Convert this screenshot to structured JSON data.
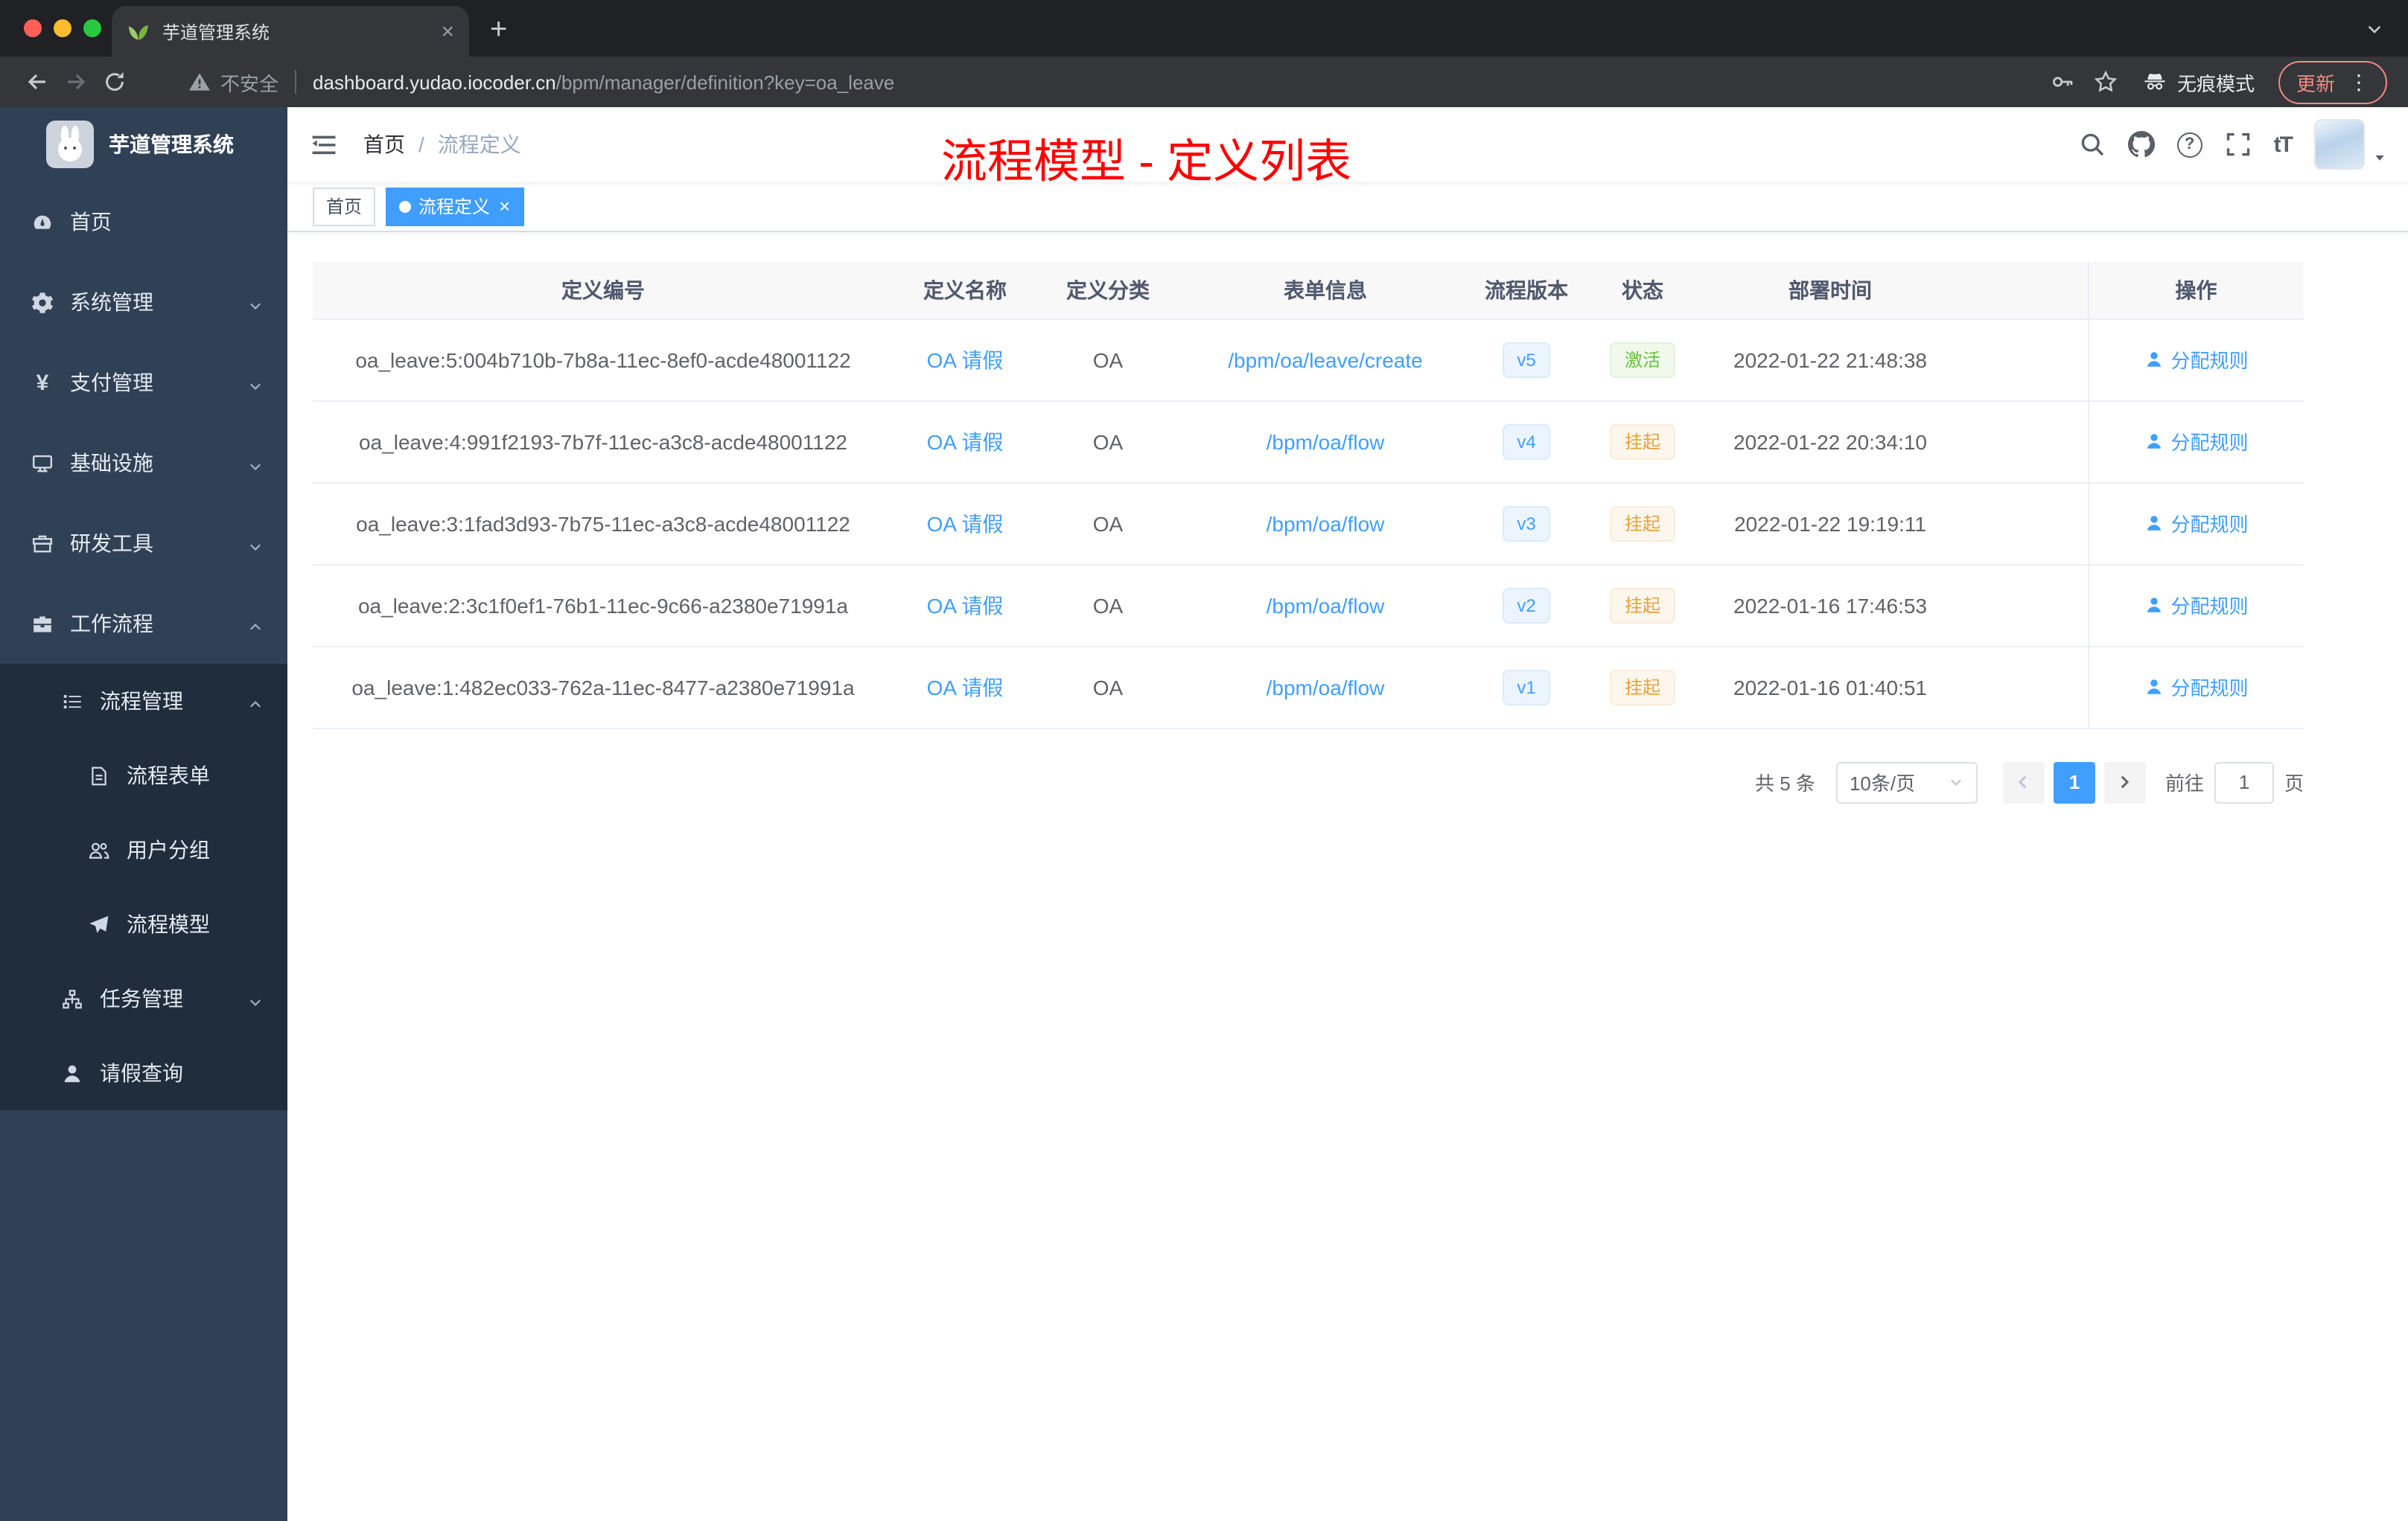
{
  "browser": {
    "tab_title": "芋道管理系统",
    "security_label": "不安全",
    "url_host": "dashboard.yudao.iocoder.cn",
    "url_path": "/bpm/manager/definition?key=oa_leave",
    "incognito_label": "无痕模式",
    "update_label": "更新"
  },
  "sidebar": {
    "title": "芋道管理系统",
    "menu": [
      {
        "name": "home",
        "label": "首页",
        "icon": "dashboard-icon",
        "level": 1
      },
      {
        "name": "system-management",
        "label": "系统管理",
        "icon": "gear-icon",
        "level": 1,
        "chevron": "down"
      },
      {
        "name": "payment-management",
        "label": "支付管理",
        "icon": "yen-icon",
        "level": 1,
        "chevron": "down"
      },
      {
        "name": "infrastructure",
        "label": "基础设施",
        "icon": "monitor-icon",
        "level": 1,
        "chevron": "down"
      },
      {
        "name": "dev-tools",
        "label": "研发工具",
        "icon": "toolbox-icon",
        "level": 1,
        "chevron": "down"
      },
      {
        "name": "workflow",
        "label": "工作流程",
        "icon": "briefcase-icon",
        "level": 1,
        "chevron": "up"
      },
      {
        "name": "process-management",
        "label": "流程管理",
        "icon": "list-icon",
        "level": 2,
        "chevron": "up",
        "sub": true
      },
      {
        "name": "process-form",
        "label": "流程表单",
        "icon": "form-icon",
        "level": 3,
        "sub": true
      },
      {
        "name": "user-group",
        "label": "用户分组",
        "icon": "group-icon",
        "level": 3,
        "sub": true
      },
      {
        "name": "process-model",
        "label": "流程模型",
        "icon": "paper-plane-icon",
        "level": 3,
        "sub": true
      },
      {
        "name": "task-management",
        "label": "任务管理",
        "icon": "org-tree-icon",
        "level": 2,
        "chevron": "down",
        "sub": true
      },
      {
        "name": "leave-query",
        "label": "请假查询",
        "icon": "person-icon",
        "level": 2,
        "sub": true
      }
    ]
  },
  "header": {
    "breadcrumb_root": "首页",
    "breadcrumb_sep": "/",
    "breadcrumb_current": "流程定义",
    "annotation": "流程模型 - 定义列表",
    "icon_glyphs": {
      "help": "?",
      "textsize": "tT"
    }
  },
  "tagsview": {
    "home": "首页",
    "active": "流程定义"
  },
  "table": {
    "columns": [
      "定义编号",
      "定义名称",
      "定义分类",
      "表单信息",
      "流程版本",
      "状态",
      "部署时间",
      "操作"
    ],
    "action_label": "分配规则",
    "rows": [
      {
        "id": "oa_leave:5:004b710b-7b8a-11ec-8ef0-acde48001122",
        "name": "OA 请假",
        "category": "OA",
        "form": "/bpm/oa/leave/create",
        "version": "v5",
        "status": "激活",
        "status_type": "success",
        "deploy_time": "2022-01-22 21:48:38"
      },
      {
        "id": "oa_leave:4:991f2193-7b7f-11ec-a3c8-acde48001122",
        "name": "OA 请假",
        "category": "OA",
        "form": "/bpm/oa/flow",
        "version": "v4",
        "status": "挂起",
        "status_type": "warning",
        "deploy_time": "2022-01-22 20:34:10"
      },
      {
        "id": "oa_leave:3:1fad3d93-7b75-11ec-a3c8-acde48001122",
        "name": "OA 请假",
        "category": "OA",
        "form": "/bpm/oa/flow",
        "version": "v3",
        "status": "挂起",
        "status_type": "warning",
        "deploy_time": "2022-01-22 19:19:11"
      },
      {
        "id": "oa_leave:2:3c1f0ef1-76b1-11ec-9c66-a2380e71991a",
        "name": "OA 请假",
        "category": "OA",
        "form": "/bpm/oa/flow",
        "version": "v2",
        "status": "挂起",
        "status_type": "warning",
        "deploy_time": "2022-01-16 17:46:53"
      },
      {
        "id": "oa_leave:1:482ec033-762a-11ec-8477-a2380e71991a",
        "name": "OA 请假",
        "category": "OA",
        "form": "/bpm/oa/flow",
        "version": "v1",
        "status": "挂起",
        "status_type": "warning",
        "deploy_time": "2022-01-16 01:40:51"
      }
    ]
  },
  "pagination": {
    "total": "共 5 条",
    "page_size": "10条/页",
    "current_page": "1",
    "goto_label": "前往",
    "goto_value": "1",
    "page_unit": "页"
  },
  "colors": {
    "accent": "#409eff",
    "success": "#67c23a",
    "warning": "#e6a23c",
    "annotation_red": "#ff0000",
    "sidebar_bg": "#304156",
    "submenu_bg": "#1f2d3d",
    "chrome_bg": "#202124",
    "toolbar_bg": "#35363a"
  }
}
